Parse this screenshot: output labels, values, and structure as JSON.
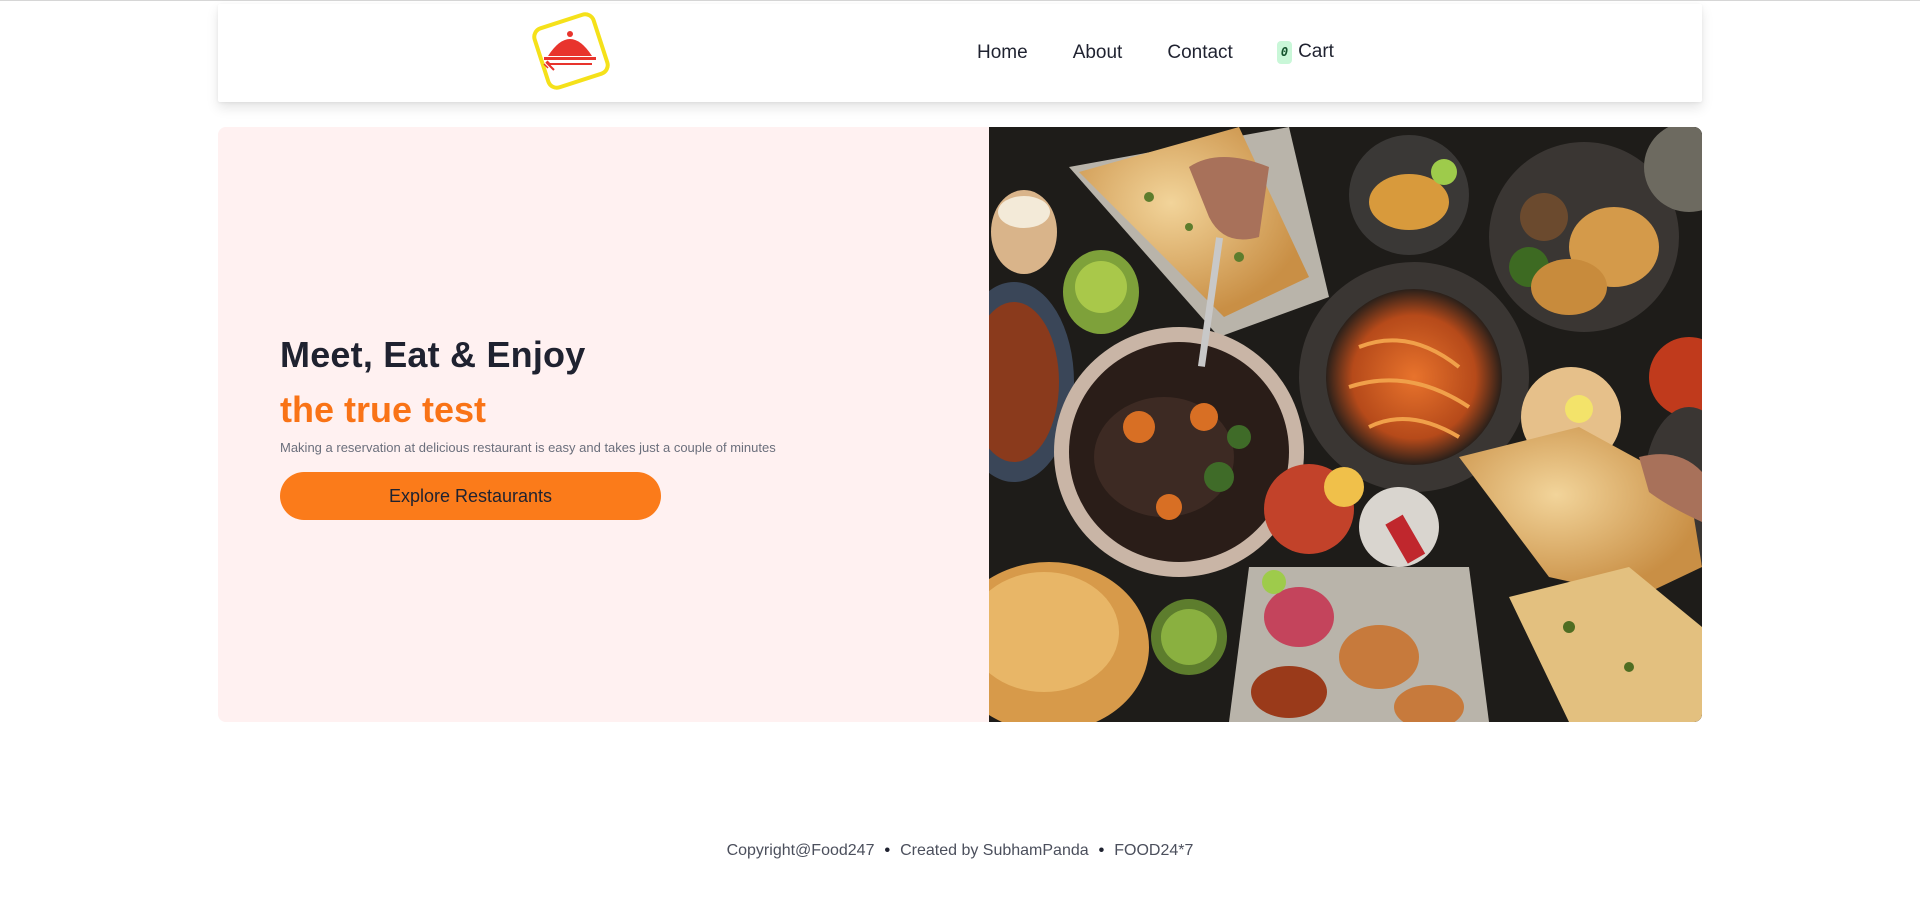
{
  "header": {
    "logo_name": "food-dome-logo",
    "nav": {
      "home": "Home",
      "about": "About",
      "contact": "Contact"
    },
    "cart": {
      "count": "0",
      "label": "Cart"
    }
  },
  "hero": {
    "title": "Meet, Eat & Enjoy",
    "subtitle": "the true test",
    "description": "Making a reservation at delicious restaurant is easy and takes just a couple of minutes",
    "button_label": "Explore Restaurants",
    "image_subject": "overhead spread of Indian dishes"
  },
  "footer": {
    "copyright": "Copyright@Food247",
    "author": "Created by SubhamPanda",
    "brand": "FOOD24*7",
    "separator": "•"
  },
  "colors": {
    "accent": "#f97316",
    "button": "#fb7b1a",
    "hero_bg": "#fff1f1",
    "cart_badge": "#c9f7d8",
    "text_dark": "#1f2230"
  }
}
